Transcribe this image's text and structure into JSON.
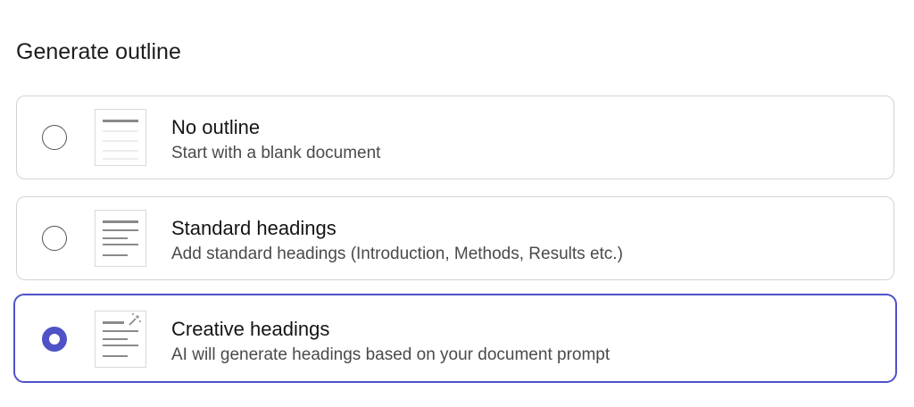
{
  "page": {
    "title": "Generate outline"
  },
  "options": [
    {
      "title": "No outline",
      "description": "Start with a blank document",
      "icon": "blank-document-icon",
      "selected": false
    },
    {
      "title": "Standard headings",
      "description": "Add standard headings (Introduction, Methods, Results etc.)",
      "icon": "headings-document-icon",
      "selected": false
    },
    {
      "title": "Creative headings",
      "description": "AI will generate headings based on your document prompt",
      "icon": "magic-headings-document-icon",
      "selected": true
    }
  ],
  "colors": {
    "accent": "#4f52c7",
    "border": "#d4d4d8",
    "text": "#1d1d1f",
    "muted_text": "#4a4a4a"
  }
}
